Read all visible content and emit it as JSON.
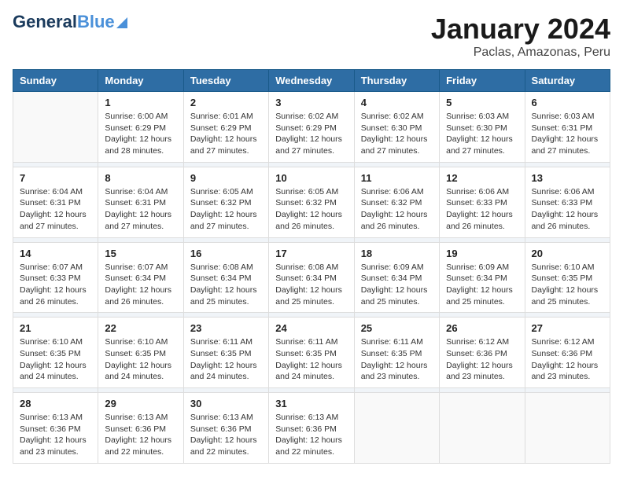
{
  "header": {
    "logo_line1": "General",
    "logo_line2": "Blue",
    "title": "January 2024",
    "subtitle": "Paclas, Amazonas, Peru"
  },
  "calendar": {
    "days_of_week": [
      "Sunday",
      "Monday",
      "Tuesday",
      "Wednesday",
      "Thursday",
      "Friday",
      "Saturday"
    ],
    "weeks": [
      [
        {
          "day": "",
          "sunrise": "",
          "sunset": "",
          "daylight": "",
          "empty": true
        },
        {
          "day": "1",
          "sunrise": "Sunrise: 6:00 AM",
          "sunset": "Sunset: 6:29 PM",
          "daylight": "Daylight: 12 hours and 28 minutes."
        },
        {
          "day": "2",
          "sunrise": "Sunrise: 6:01 AM",
          "sunset": "Sunset: 6:29 PM",
          "daylight": "Daylight: 12 hours and 27 minutes."
        },
        {
          "day": "3",
          "sunrise": "Sunrise: 6:02 AM",
          "sunset": "Sunset: 6:29 PM",
          "daylight": "Daylight: 12 hours and 27 minutes."
        },
        {
          "day": "4",
          "sunrise": "Sunrise: 6:02 AM",
          "sunset": "Sunset: 6:30 PM",
          "daylight": "Daylight: 12 hours and 27 minutes."
        },
        {
          "day": "5",
          "sunrise": "Sunrise: 6:03 AM",
          "sunset": "Sunset: 6:30 PM",
          "daylight": "Daylight: 12 hours and 27 minutes."
        },
        {
          "day": "6",
          "sunrise": "Sunrise: 6:03 AM",
          "sunset": "Sunset: 6:31 PM",
          "daylight": "Daylight: 12 hours and 27 minutes."
        }
      ],
      [
        {
          "day": "7",
          "sunrise": "Sunrise: 6:04 AM",
          "sunset": "Sunset: 6:31 PM",
          "daylight": "Daylight: 12 hours and 27 minutes."
        },
        {
          "day": "8",
          "sunrise": "Sunrise: 6:04 AM",
          "sunset": "Sunset: 6:31 PM",
          "daylight": "Daylight: 12 hours and 27 minutes."
        },
        {
          "day": "9",
          "sunrise": "Sunrise: 6:05 AM",
          "sunset": "Sunset: 6:32 PM",
          "daylight": "Daylight: 12 hours and 27 minutes."
        },
        {
          "day": "10",
          "sunrise": "Sunrise: 6:05 AM",
          "sunset": "Sunset: 6:32 PM",
          "daylight": "Daylight: 12 hours and 26 minutes."
        },
        {
          "day": "11",
          "sunrise": "Sunrise: 6:06 AM",
          "sunset": "Sunset: 6:32 PM",
          "daylight": "Daylight: 12 hours and 26 minutes."
        },
        {
          "day": "12",
          "sunrise": "Sunrise: 6:06 AM",
          "sunset": "Sunset: 6:33 PM",
          "daylight": "Daylight: 12 hours and 26 minutes."
        },
        {
          "day": "13",
          "sunrise": "Sunrise: 6:06 AM",
          "sunset": "Sunset: 6:33 PM",
          "daylight": "Daylight: 12 hours and 26 minutes."
        }
      ],
      [
        {
          "day": "14",
          "sunrise": "Sunrise: 6:07 AM",
          "sunset": "Sunset: 6:33 PM",
          "daylight": "Daylight: 12 hours and 26 minutes."
        },
        {
          "day": "15",
          "sunrise": "Sunrise: 6:07 AM",
          "sunset": "Sunset: 6:34 PM",
          "daylight": "Daylight: 12 hours and 26 minutes."
        },
        {
          "day": "16",
          "sunrise": "Sunrise: 6:08 AM",
          "sunset": "Sunset: 6:34 PM",
          "daylight": "Daylight: 12 hours and 25 minutes."
        },
        {
          "day": "17",
          "sunrise": "Sunrise: 6:08 AM",
          "sunset": "Sunset: 6:34 PM",
          "daylight": "Daylight: 12 hours and 25 minutes."
        },
        {
          "day": "18",
          "sunrise": "Sunrise: 6:09 AM",
          "sunset": "Sunset: 6:34 PM",
          "daylight": "Daylight: 12 hours and 25 minutes."
        },
        {
          "day": "19",
          "sunrise": "Sunrise: 6:09 AM",
          "sunset": "Sunset: 6:34 PM",
          "daylight": "Daylight: 12 hours and 25 minutes."
        },
        {
          "day": "20",
          "sunrise": "Sunrise: 6:10 AM",
          "sunset": "Sunset: 6:35 PM",
          "daylight": "Daylight: 12 hours and 25 minutes."
        }
      ],
      [
        {
          "day": "21",
          "sunrise": "Sunrise: 6:10 AM",
          "sunset": "Sunset: 6:35 PM",
          "daylight": "Daylight: 12 hours and 24 minutes."
        },
        {
          "day": "22",
          "sunrise": "Sunrise: 6:10 AM",
          "sunset": "Sunset: 6:35 PM",
          "daylight": "Daylight: 12 hours and 24 minutes."
        },
        {
          "day": "23",
          "sunrise": "Sunrise: 6:11 AM",
          "sunset": "Sunset: 6:35 PM",
          "daylight": "Daylight: 12 hours and 24 minutes."
        },
        {
          "day": "24",
          "sunrise": "Sunrise: 6:11 AM",
          "sunset": "Sunset: 6:35 PM",
          "daylight": "Daylight: 12 hours and 24 minutes."
        },
        {
          "day": "25",
          "sunrise": "Sunrise: 6:11 AM",
          "sunset": "Sunset: 6:35 PM",
          "daylight": "Daylight: 12 hours and 23 minutes."
        },
        {
          "day": "26",
          "sunrise": "Sunrise: 6:12 AM",
          "sunset": "Sunset: 6:36 PM",
          "daylight": "Daylight: 12 hours and 23 minutes."
        },
        {
          "day": "27",
          "sunrise": "Sunrise: 6:12 AM",
          "sunset": "Sunset: 6:36 PM",
          "daylight": "Daylight: 12 hours and 23 minutes."
        }
      ],
      [
        {
          "day": "28",
          "sunrise": "Sunrise: 6:13 AM",
          "sunset": "Sunset: 6:36 PM",
          "daylight": "Daylight: 12 hours and 23 minutes."
        },
        {
          "day": "29",
          "sunrise": "Sunrise: 6:13 AM",
          "sunset": "Sunset: 6:36 PM",
          "daylight": "Daylight: 12 hours and 22 minutes."
        },
        {
          "day": "30",
          "sunrise": "Sunrise: 6:13 AM",
          "sunset": "Sunset: 6:36 PM",
          "daylight": "Daylight: 12 hours and 22 minutes."
        },
        {
          "day": "31",
          "sunrise": "Sunrise: 6:13 AM",
          "sunset": "Sunset: 6:36 PM",
          "daylight": "Daylight: 12 hours and 22 minutes."
        },
        {
          "day": "",
          "sunrise": "",
          "sunset": "",
          "daylight": "",
          "empty": true
        },
        {
          "day": "",
          "sunrise": "",
          "sunset": "",
          "daylight": "",
          "empty": true
        },
        {
          "day": "",
          "sunrise": "",
          "sunset": "",
          "daylight": "",
          "empty": true
        }
      ]
    ]
  }
}
